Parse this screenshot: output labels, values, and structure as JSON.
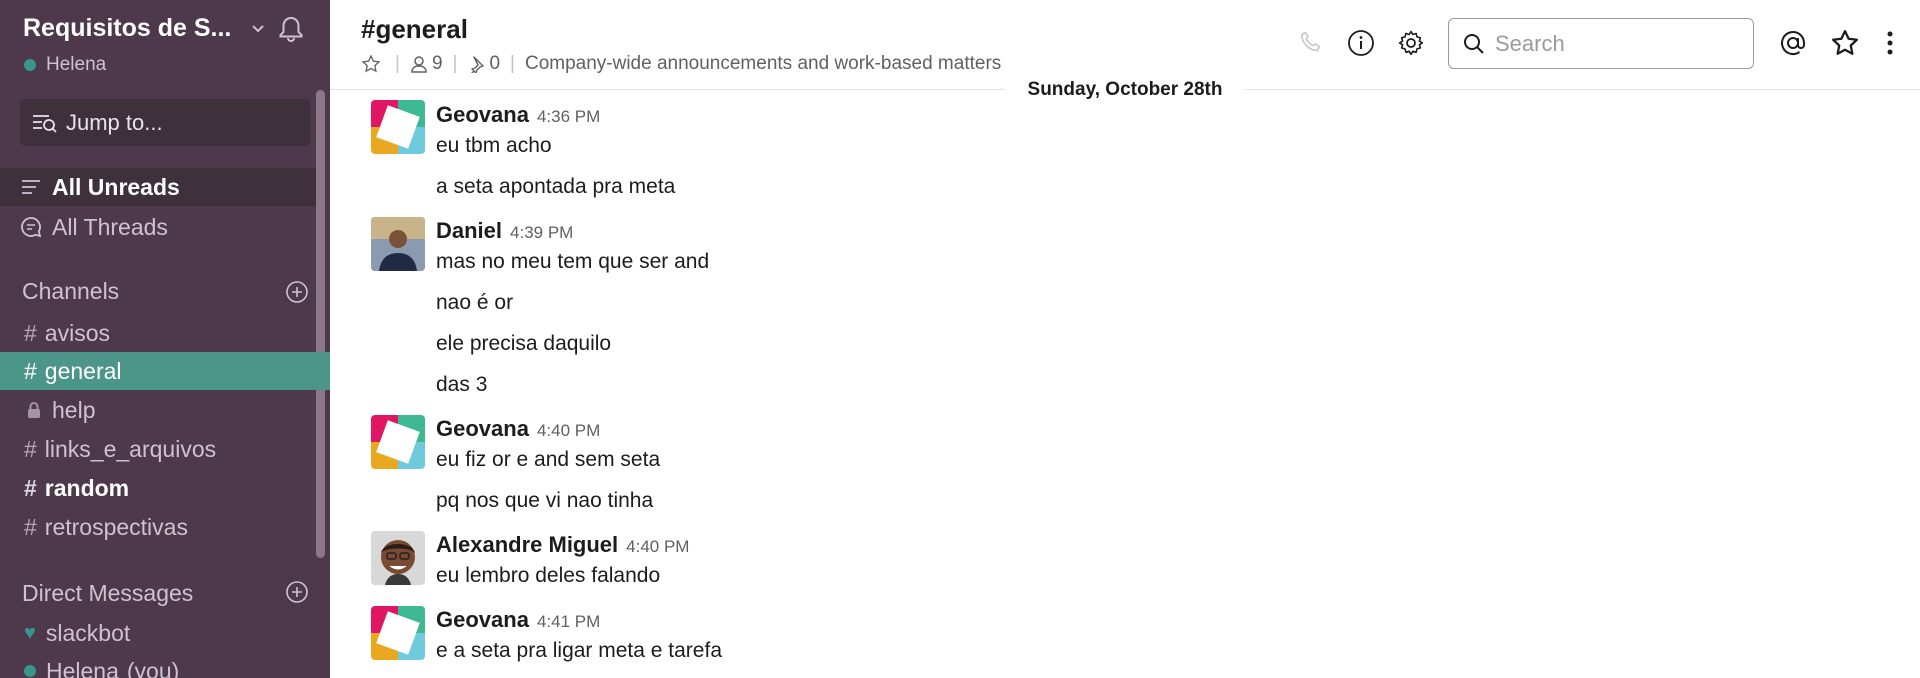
{
  "sidebar": {
    "team_name": "Requisitos de S...",
    "user": "Helena",
    "jump_placeholder": "Jump to...",
    "nav": [
      {
        "label": "All Unreads"
      },
      {
        "label": "All Threads"
      }
    ],
    "channels_heading": "Channels",
    "channels": [
      {
        "label": "avisos",
        "type": "public"
      },
      {
        "label": "general",
        "type": "public",
        "active": true
      },
      {
        "label": "help",
        "type": "private"
      },
      {
        "label": "links_e_arquivos",
        "type": "public"
      },
      {
        "label": "random",
        "type": "public",
        "unread": true
      },
      {
        "label": "retrospectivas",
        "type": "public"
      }
    ],
    "dm_heading": "Direct Messages",
    "dms": [
      {
        "label": "slackbot",
        "icon": "heart-icon"
      },
      {
        "label": "Helena",
        "suffix": "(you)"
      }
    ],
    "colors": {
      "bg": "#4d394b",
      "active": "#4c9689",
      "presence": "#38978d"
    }
  },
  "header": {
    "channel": "#general",
    "members": "9",
    "pins": "0",
    "topic": "Company-wide announcements and work-based matters",
    "search_placeholder": "Search"
  },
  "date_divider": "Sunday, October 28th",
  "messages": [
    {
      "author": "Geovana",
      "time": "4:36 PM",
      "avatar": "slack-logo",
      "lines": [
        "eu tbm acho",
        "a seta apontada pra meta"
      ]
    },
    {
      "author": "Daniel",
      "time": "4:39 PM",
      "avatar": "photo",
      "lines": [
        "mas no meu tem que ser and",
        "nao é or",
        "ele precisa daquilo",
        "das 3"
      ]
    },
    {
      "author": "Geovana",
      "time": "4:40 PM",
      "avatar": "slack-logo",
      "lines": [
        "eu fiz or e and sem seta",
        "pq nos que vi nao tinha"
      ]
    },
    {
      "author": "Alexandre Miguel",
      "time": "4:40 PM",
      "avatar": "photo",
      "lines": [
        "eu lembro deles falando"
      ]
    },
    {
      "author": "Geovana",
      "time": "4:41 PM",
      "avatar": "slack-logo",
      "lines": [
        "e a seta pra ligar meta e tarefa"
      ]
    }
  ]
}
